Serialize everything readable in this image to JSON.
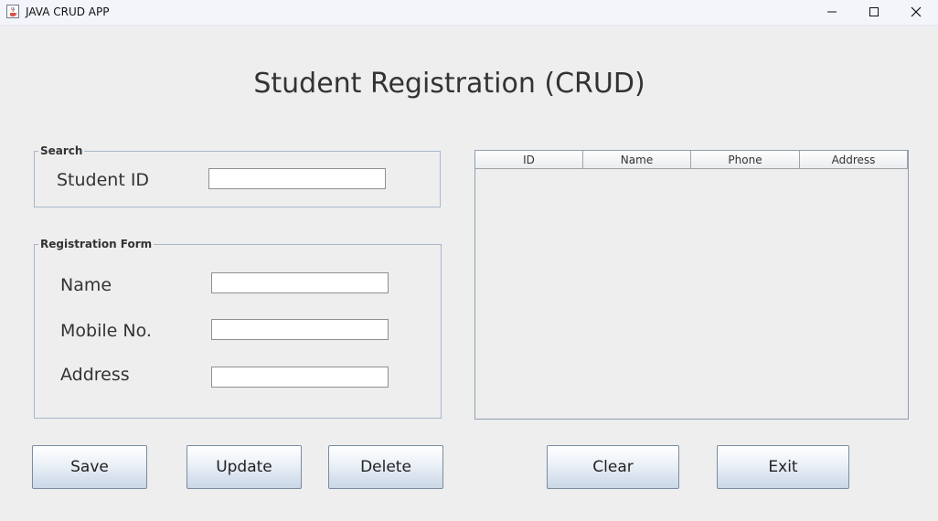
{
  "window": {
    "title": "JAVA CRUD APP",
    "controls": [
      "minimize",
      "maximize",
      "close"
    ]
  },
  "page": {
    "title": "Student Registration (CRUD)"
  },
  "search": {
    "legend": "Search",
    "student_id_label": "Student ID",
    "student_id_value": ""
  },
  "form": {
    "legend": "Registration Form",
    "name_label": "Name",
    "name_value": "",
    "mobile_label": "Mobile No.",
    "mobile_value": "",
    "address_label": "Address",
    "address_value": ""
  },
  "table": {
    "columns": [
      "ID",
      "Name",
      "Phone",
      "Address"
    ],
    "rows": []
  },
  "buttons": {
    "save": "Save",
    "update": "Update",
    "delete": "Delete",
    "clear": "Clear",
    "exit": "Exit"
  },
  "icons": {
    "app": "java-cup-icon",
    "minimize": "minimize-icon",
    "maximize": "maximize-icon",
    "close": "close-icon"
  },
  "colors": {
    "background": "#eeeeee",
    "panel_border": "#a7b8cc",
    "button_gradient_bottom": "#c9d7e6"
  }
}
